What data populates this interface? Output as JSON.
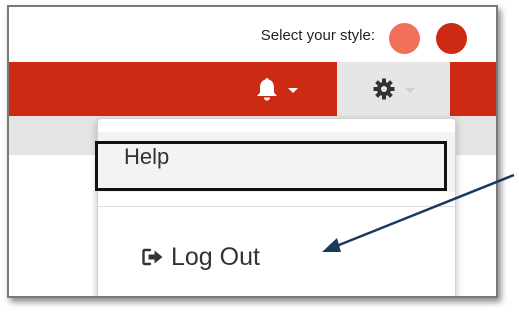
{
  "header": {
    "style_label": "Select your style:",
    "swatches": [
      {
        "name": "light-red",
        "color": "#f0705a"
      },
      {
        "name": "dark-red",
        "color": "#cc2a12"
      }
    ]
  },
  "navbar": {
    "background": "#cc2a12",
    "icons": [
      "bell-icon",
      "gear-icon"
    ]
  },
  "dropdown": {
    "items": [
      {
        "label": "Help"
      },
      {
        "label": "Log Out",
        "icon": "sign-out-icon"
      }
    ]
  },
  "annotation": {
    "color": "#1a3a5c",
    "points_to": "Log Out"
  }
}
